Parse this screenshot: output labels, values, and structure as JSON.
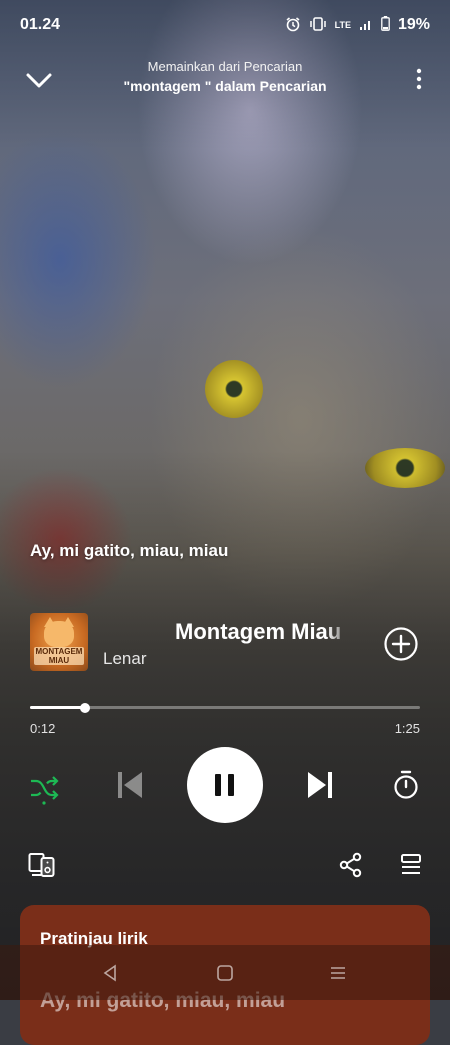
{
  "status_bar": {
    "time": "01.24",
    "network": "LTE",
    "battery": "19%"
  },
  "header": {
    "context_label": "Memainkan dari Pencarian",
    "context_title": "\"montagem \" dalam Pencarian"
  },
  "lyric_line": "Ay, mi gatito, miau, miau",
  "track": {
    "title": "Montagem Miau",
    "artist": "Lenar",
    "album_art_text": "MONTAGEM MIAU"
  },
  "playback": {
    "position": "0:12",
    "duration": "1:25",
    "progress_fraction": 0.14
  },
  "colors": {
    "shuffle_active": "#1db954",
    "lyrics_card": "#7a2e19"
  },
  "lyrics_card": {
    "heading": "Pratinjau lirik",
    "preview": "Ay, mi gatito, miau, miau"
  },
  "icons": {
    "collapse": "chevron-down-icon",
    "more": "more-vertical-icon",
    "add": "plus-circle-icon",
    "shuffle": "shuffle-icon",
    "previous": "skip-previous-icon",
    "play_pause": "pause-icon",
    "next": "skip-next-icon",
    "sleep_timer": "timer-icon",
    "devices": "devices-icon",
    "share": "share-icon",
    "queue": "queue-icon"
  }
}
